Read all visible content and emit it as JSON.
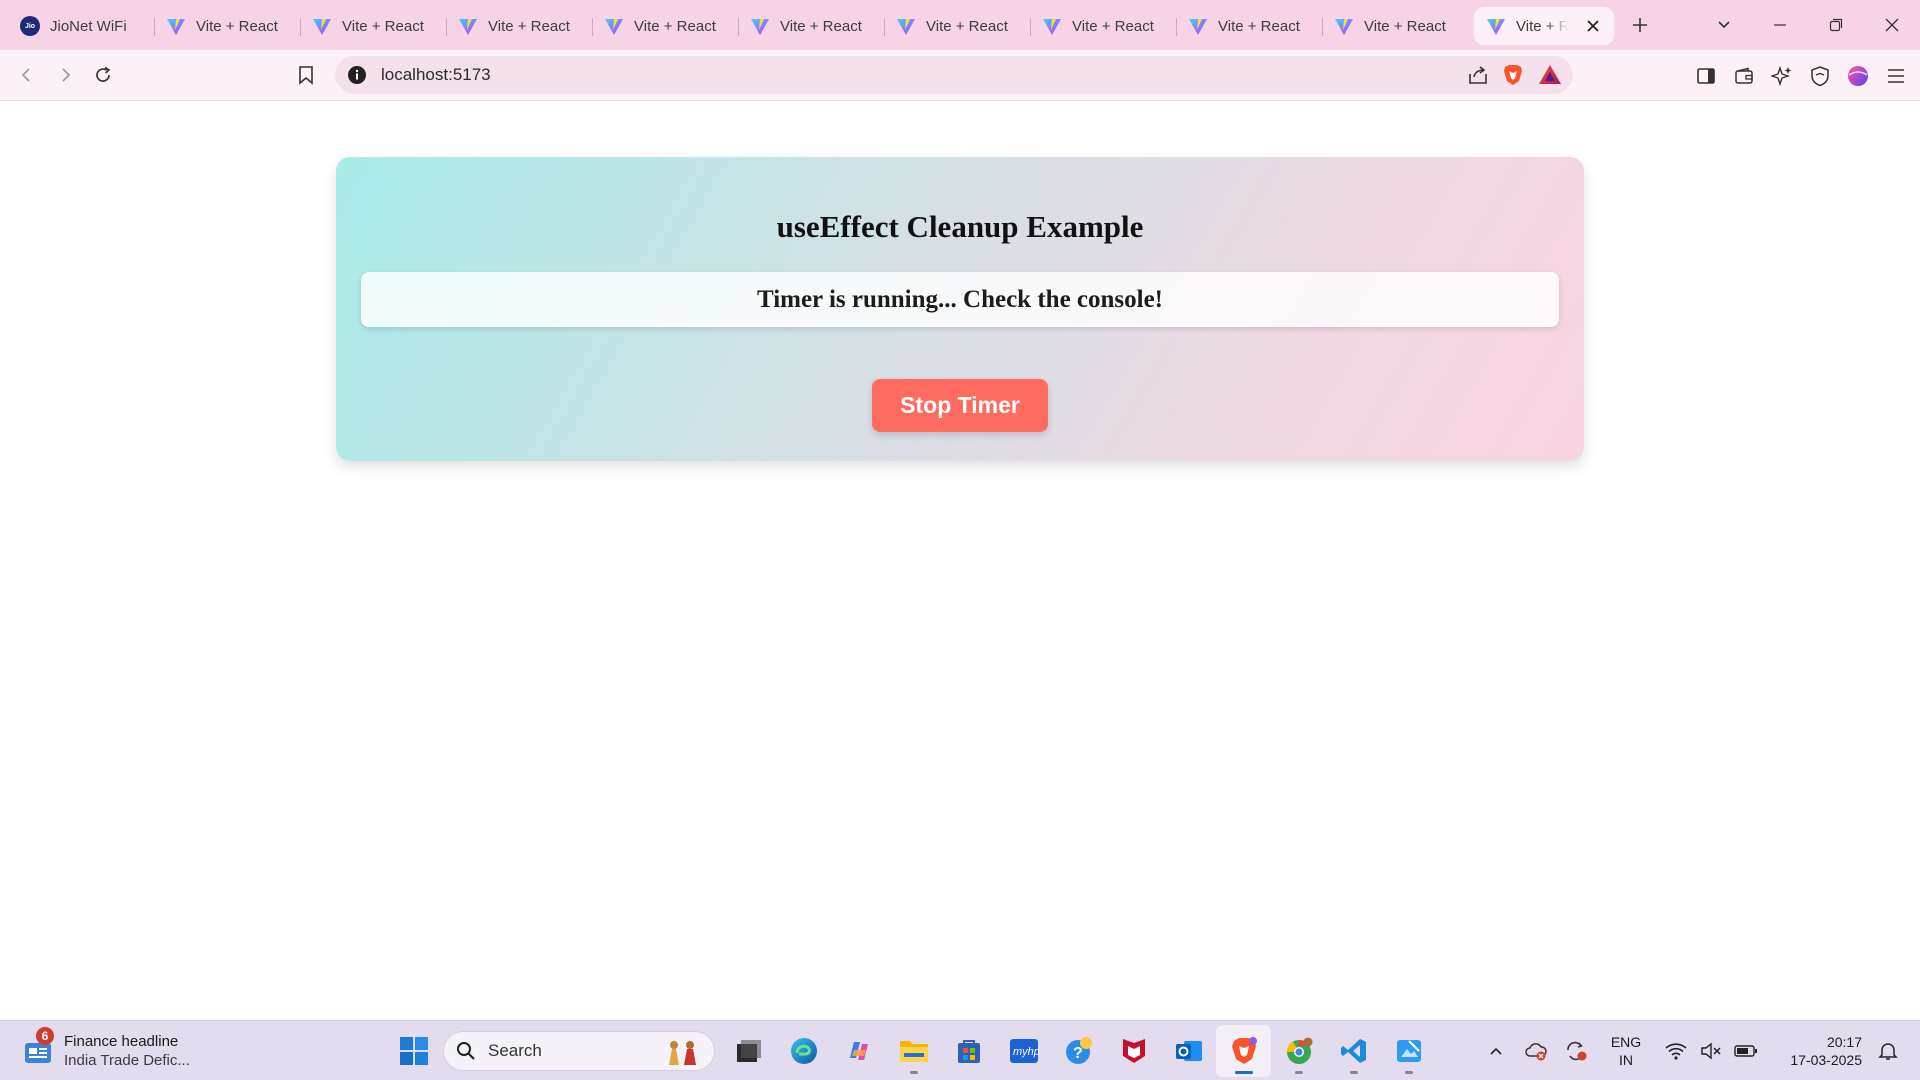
{
  "browser": {
    "tabs": [
      {
        "label": "JioNet WiFi",
        "icon": "jio-icon"
      },
      {
        "label": "Vite + React",
        "icon": "vite-icon"
      },
      {
        "label": "Vite + React",
        "icon": "vite-icon"
      },
      {
        "label": "Vite + React",
        "icon": "vite-icon"
      },
      {
        "label": "Vite + React",
        "icon": "vite-icon"
      },
      {
        "label": "Vite + React",
        "icon": "vite-icon"
      },
      {
        "label": "Vite + React",
        "icon": "vite-icon"
      },
      {
        "label": "Vite + React",
        "icon": "vite-icon"
      },
      {
        "label": "Vite + React",
        "icon": "vite-icon"
      },
      {
        "label": "Vite + React",
        "icon": "vite-icon"
      },
      {
        "label": "Vite + React",
        "icon": "vite-icon",
        "active": true
      }
    ],
    "jio_logo_text": "Jio",
    "address": "localhost:5173",
    "colors": {
      "tab_strip": "#f7d3e6",
      "toolbar": "#fdf1f7",
      "omnibox": "#f5e1ec"
    }
  },
  "page": {
    "heading": "useEffect Cleanup Example",
    "status": "Timer is running... Check the console!",
    "button_label": "Stop Timer",
    "colors": {
      "button": "#ff6b61",
      "gradient_start": "#a7ebe8",
      "gradient_end": "#f9d4e2"
    }
  },
  "taskbar": {
    "news": {
      "badge": "6",
      "title": "Finance headline",
      "subtitle": "India Trade Defic..."
    },
    "search_label": "Search",
    "language": {
      "line1": "ENG",
      "line2": "IN"
    },
    "clock": {
      "time": "20:17",
      "date": "17-03-2025"
    }
  }
}
